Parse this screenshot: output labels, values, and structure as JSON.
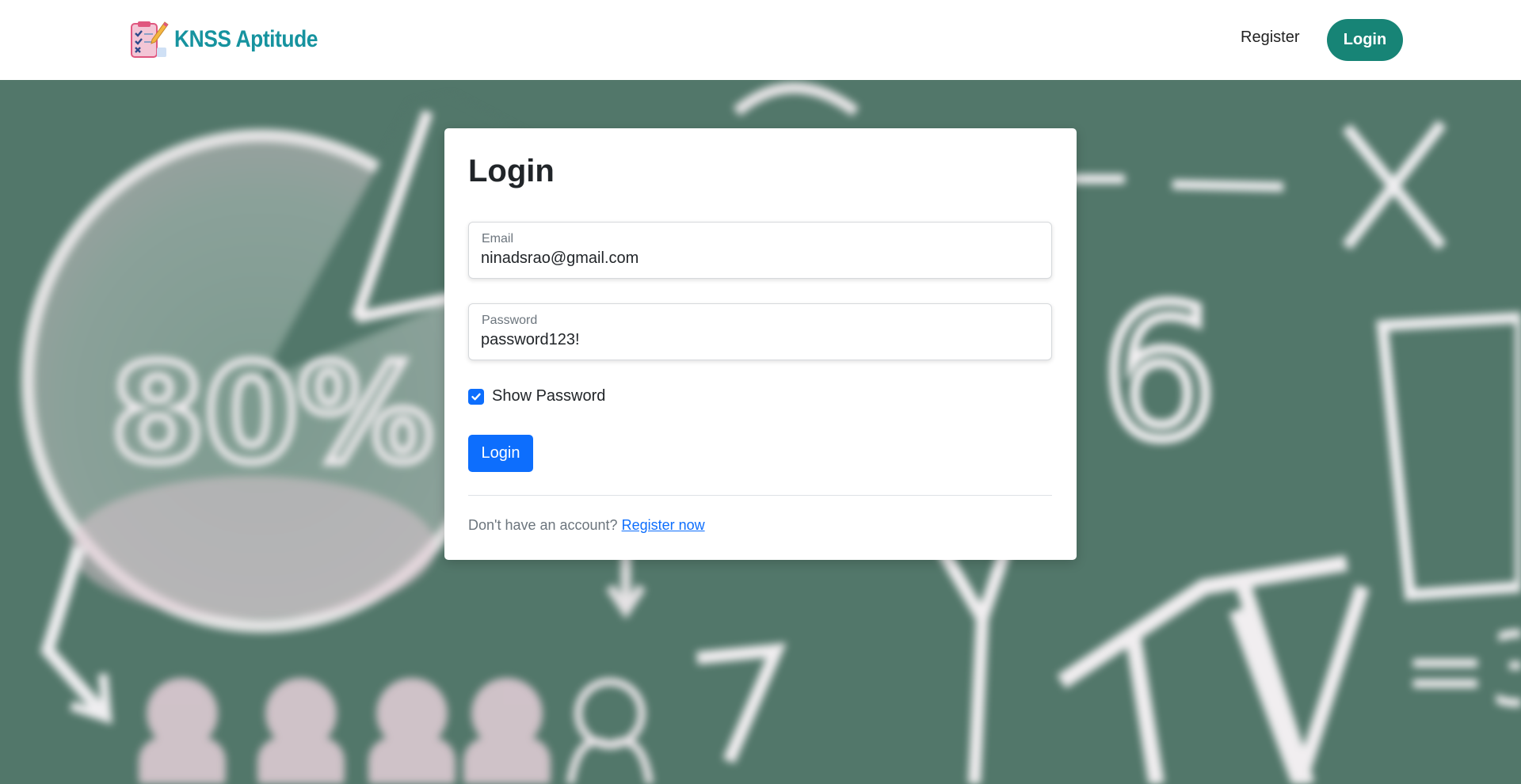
{
  "brand": {
    "name": "KNSS Aptitude",
    "logo_icon": "checklist-pencil-icon"
  },
  "nav": {
    "register_label": "Register",
    "login_label": "Login"
  },
  "login_card": {
    "title": "Login",
    "email": {
      "label": "Email",
      "value": "ninadsrao@gmail.com"
    },
    "password": {
      "label": "Password",
      "value": "password123!"
    },
    "show_password": {
      "label": "Show Password",
      "checked": true
    },
    "submit_label": "Login",
    "footer_prompt": "Don't have an account?",
    "footer_link": "Register now"
  },
  "colors": {
    "brand_teal": "#16939f",
    "nav_login_bg": "#178476",
    "primary_blue": "#0d6efd",
    "chalkboard_green": "#52776a"
  }
}
